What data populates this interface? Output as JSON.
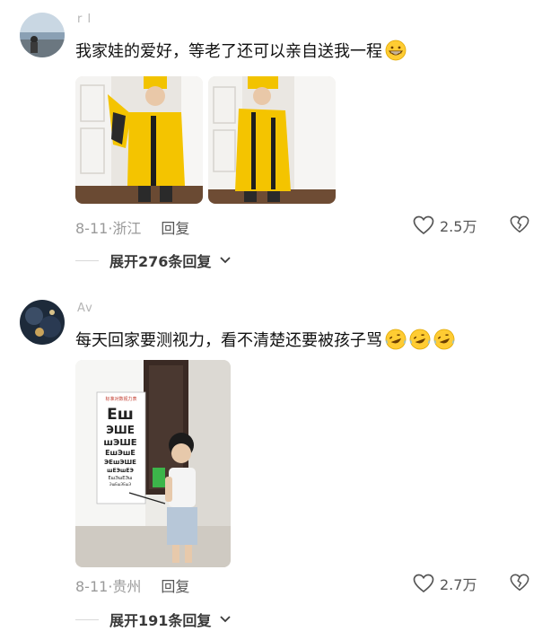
{
  "comments": [
    {
      "username": "r l",
      "text": "我家娃的爱好，等老了还可以亲自送我一程",
      "emoji": "grinning-face",
      "date": "8-11",
      "location": "浙江",
      "reply_label": "回复",
      "likes": "2.5万",
      "expand_label": "展开276条回复"
    },
    {
      "username": "Av",
      "text": "每天回家要测视力，看不清楚还要被孩子骂",
      "emoji": "rolling-on-floor-laughing",
      "emoji_count": 3,
      "date": "8-11",
      "location": "贵州",
      "reply_label": "回复",
      "likes": "2.7万",
      "expand_label": "展开191条回复"
    }
  ],
  "eye_chart_title": "标准对数视力表",
  "colors": {
    "accent_yellow": "#f4c400",
    "text_grey": "#9a9a9a"
  }
}
